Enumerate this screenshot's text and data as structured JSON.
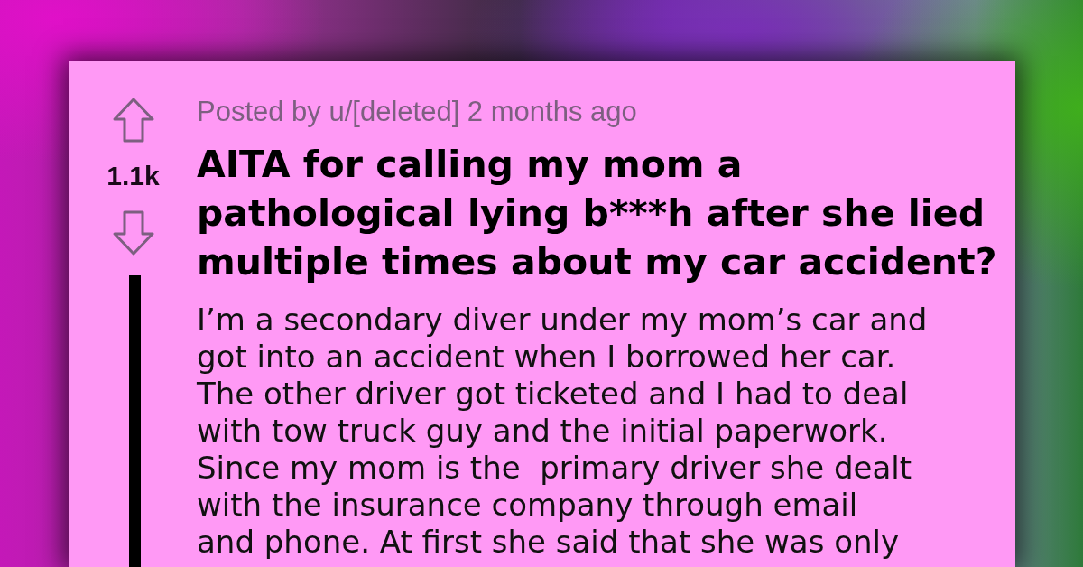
{
  "vote": {
    "score": "1.1k"
  },
  "post": {
    "meta": "Posted by u/[deleted] 2 months ago",
    "title": "AITA for calling my mom a\npathological lying b***h after she lied\nmultiple times about my car accident?",
    "body": "I’m a secondary diver under my mom’s car and\ngot into an accident when I borrowed her car.\nThe other driver got ticketed and I had to deal\nwith tow truck guy and the initial paperwork.\nSince my mom is the  primary driver she dealt\nwith the insurance company through email\nand phone. At first she said that she was only"
  }
}
